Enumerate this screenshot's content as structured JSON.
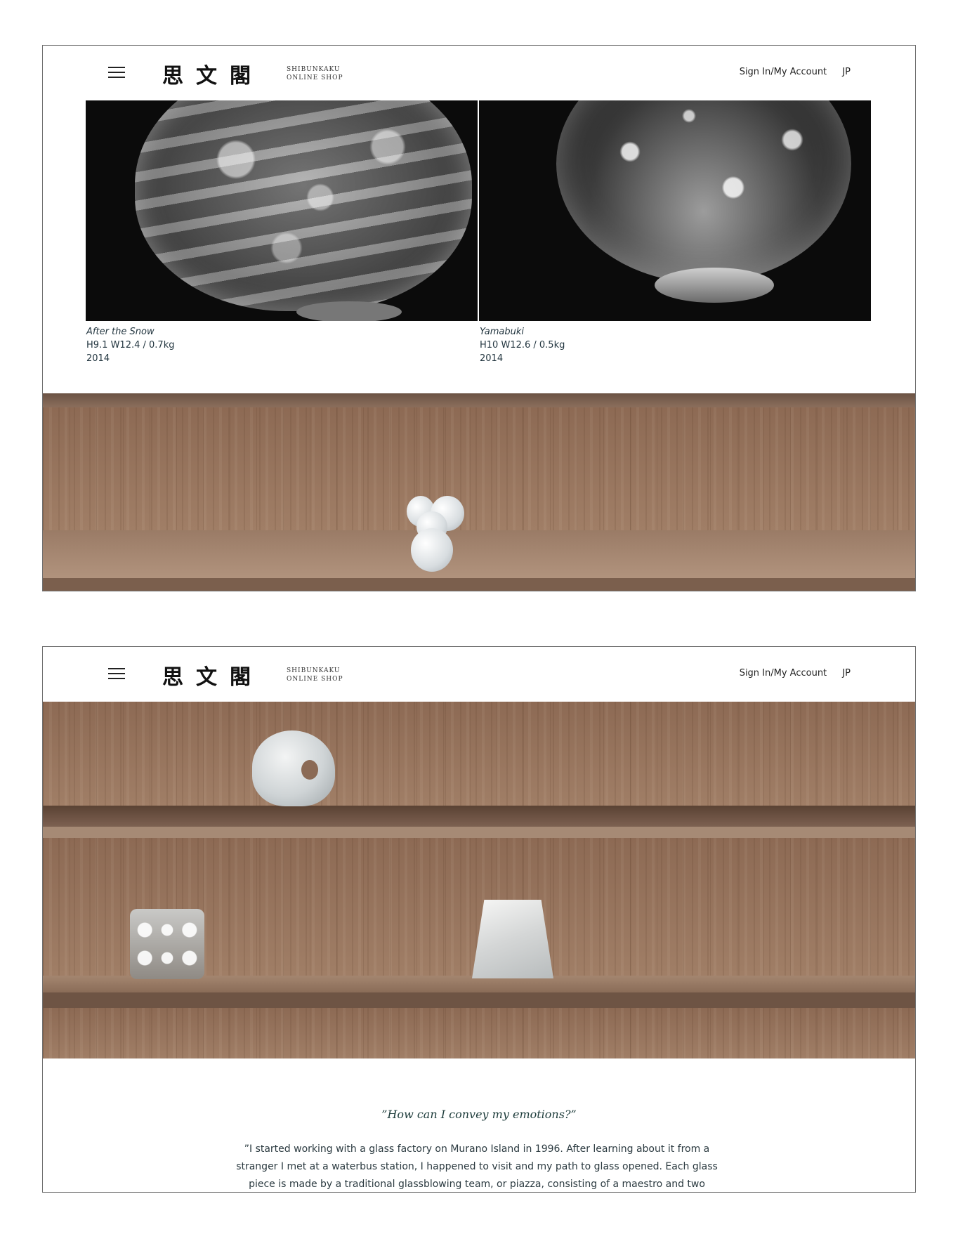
{
  "header": {
    "logo_kanji": "思文閣",
    "logo_line1": "SHIBUNKAKU",
    "logo_line2": "ONLINE SHOP",
    "sign_in": "Sign In/My Account",
    "language": "JP"
  },
  "products": [
    {
      "title": "After the Snow",
      "dimensions": "H9.1 W12.4 / 0.7kg",
      "year": "2014"
    },
    {
      "title": "Yamabuki",
      "dimensions": "H10 W12.6 / 0.5kg",
      "year": "2014"
    }
  ],
  "quote": "”How can I convey my emotions?”",
  "body_text": "”I started working with a glass factory on Murano Island in 1996. After learning about it from a stranger I met at a waterbus station, I happened to visit and my path to glass opened. Each glass piece is made by a traditional glassblowing team, or piazza, consisting of a maestro and two serventi (assistants). I have been"
}
